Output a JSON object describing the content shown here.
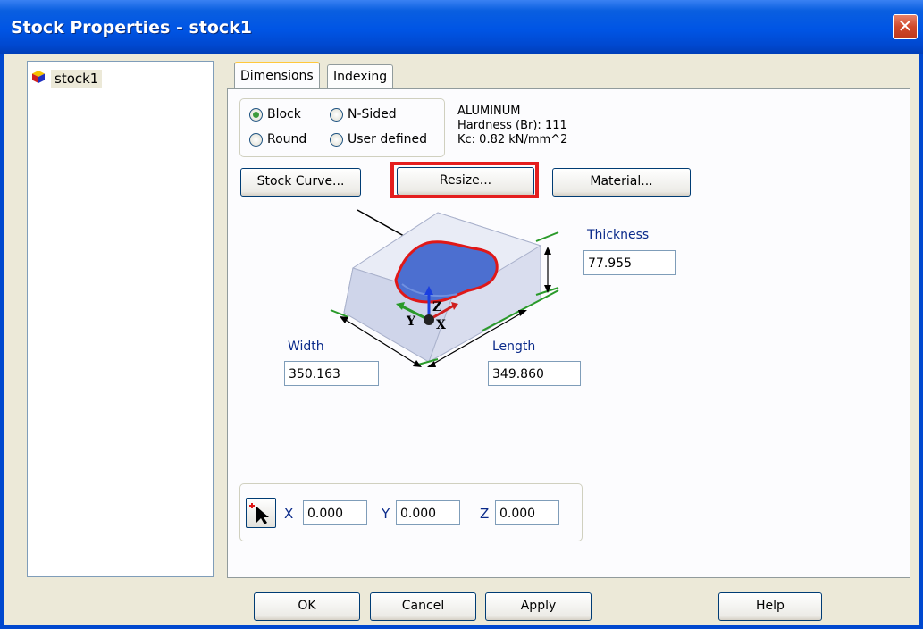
{
  "window": {
    "title": "Stock Properties - stock1",
    "close_glyph": "✕"
  },
  "tree": {
    "items": [
      {
        "label": "stock1",
        "icon": "stock-cube-icon"
      }
    ]
  },
  "tabs": [
    {
      "label": "Dimensions",
      "active": true
    },
    {
      "label": "Indexing",
      "active": false
    }
  ],
  "shape": {
    "options": [
      {
        "label": "Block",
        "selected": true
      },
      {
        "label": "N-Sided",
        "selected": false
      },
      {
        "label": "Round",
        "selected": false
      },
      {
        "label": "User defined",
        "selected": false
      }
    ]
  },
  "material": {
    "name": "ALUMINUM",
    "hardness": "Hardness (Br): 111",
    "kc": "Kc: 0.82 kN/mm^2"
  },
  "buttons": {
    "stock_curve": "Stock Curve...",
    "resize": "Resize...",
    "material": "Material..."
  },
  "dimensions": {
    "thickness": {
      "label": "Thickness",
      "value": "77.955"
    },
    "width": {
      "label": "Width",
      "value": "350.163"
    },
    "length": {
      "label": "Length",
      "value": "349.860"
    }
  },
  "diagram": {
    "axis_x": "X",
    "axis_y": "Y",
    "axis_z": "Z"
  },
  "origin": {
    "x_label": "X",
    "x_value": "0.000",
    "y_label": "Y",
    "y_value": "0.000",
    "z_label": "Z",
    "z_value": "0.000"
  },
  "footer": {
    "ok": "OK",
    "cancel": "Cancel",
    "apply": "Apply",
    "help": "Help"
  },
  "colors": {
    "highlight": "#e41e1e",
    "title_bar": "#0055e5"
  }
}
